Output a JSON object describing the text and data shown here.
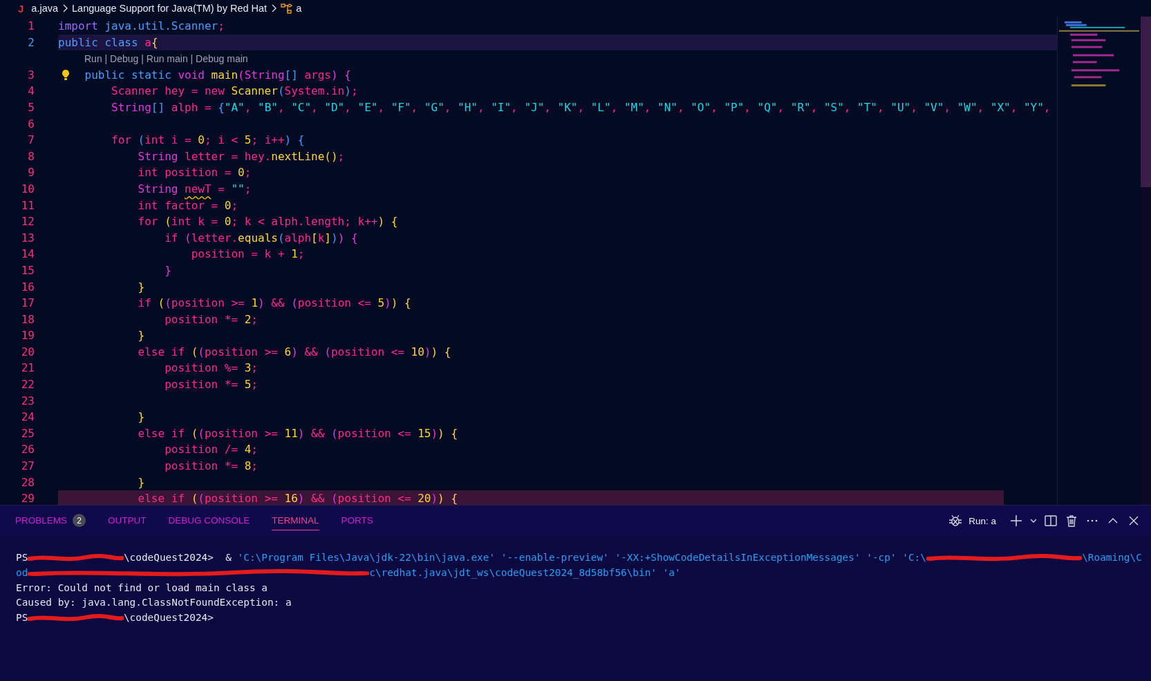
{
  "breadcrumb": {
    "file_icon": "J",
    "file": "a.java",
    "extension": "Language Support for Java(TM) by Red Hat",
    "symbol": "a"
  },
  "editor": {
    "lines": [
      {
        "kind": "code",
        "number": "1",
        "tokens": [
          {
            "kind": "im",
            "text": "import"
          },
          {
            "kind": "kw",
            "text": " java.util.Scanner"
          },
          {
            "kind": "id",
            "text": ";"
          }
        ]
      },
      {
        "kind": "current",
        "number": "2",
        "tokens": [
          {
            "kind": "kw",
            "text": "public class "
          },
          {
            "kind": "id",
            "text": "a"
          },
          {
            "kind": "y",
            "text": "{"
          }
        ]
      },
      {
        "kind": "codelens",
        "text": "Run | Debug | Run main | Debug main"
      },
      {
        "kind": "hint",
        "number": "3",
        "tokens": [
          {
            "kind": "kw",
            "text": "    public static "
          },
          {
            "kind": "ty",
            "text": "void "
          },
          {
            "kind": "fn",
            "text": "main"
          },
          {
            "kind": "m",
            "text": "("
          },
          {
            "kind": "ty",
            "text": "String"
          },
          {
            "kind": "b",
            "text": "[]"
          },
          {
            "kind": "id",
            "text": " args"
          },
          {
            "kind": "m",
            "text": ")"
          },
          {
            "kind": "m",
            "text": " {"
          }
        ]
      },
      {
        "kind": "code",
        "number": "4",
        "tokens": [
          {
            "kind": "id",
            "text": "        Scanner hey = new "
          },
          {
            "kind": "fn",
            "text": "Scanner"
          },
          {
            "kind": "b",
            "text": "("
          },
          {
            "kind": "id",
            "text": "System.in"
          },
          {
            "kind": "b",
            "text": ")"
          },
          {
            "kind": "id",
            "text": ";"
          }
        ]
      },
      {
        "kind": "code",
        "number": "5",
        "tokens": [
          {
            "kind": "ty",
            "text": "        String"
          },
          {
            "kind": "b",
            "text": "[]"
          },
          {
            "kind": "id",
            "text": " alph = "
          },
          {
            "kind": "b",
            "text": "{"
          },
          {
            "kind": "str",
            "text": "\"A\""
          },
          {
            "kind": "id",
            "text": ", "
          },
          {
            "kind": "str",
            "text": "\"B\""
          },
          {
            "kind": "id",
            "text": ", "
          },
          {
            "kind": "str",
            "text": "\"C\""
          },
          {
            "kind": "id",
            "text": ", "
          },
          {
            "kind": "str",
            "text": "\"D\""
          },
          {
            "kind": "id",
            "text": ", "
          },
          {
            "kind": "str",
            "text": "\"E\""
          },
          {
            "kind": "id",
            "text": ", "
          },
          {
            "kind": "str",
            "text": "\"F\""
          },
          {
            "kind": "id",
            "text": ", "
          },
          {
            "kind": "str",
            "text": "\"G\""
          },
          {
            "kind": "id",
            "text": ", "
          },
          {
            "kind": "str",
            "text": "\"H\""
          },
          {
            "kind": "id",
            "text": ", "
          },
          {
            "kind": "str",
            "text": "\"I\""
          },
          {
            "kind": "id",
            "text": ", "
          },
          {
            "kind": "str",
            "text": "\"J\""
          },
          {
            "kind": "id",
            "text": ", "
          },
          {
            "kind": "str",
            "text": "\"K\""
          },
          {
            "kind": "id",
            "text": ", "
          },
          {
            "kind": "str",
            "text": "\"L\""
          },
          {
            "kind": "id",
            "text": ", "
          },
          {
            "kind": "str",
            "text": "\"M\""
          },
          {
            "kind": "id",
            "text": ", "
          },
          {
            "kind": "str",
            "text": "\"N\""
          },
          {
            "kind": "id",
            "text": ", "
          },
          {
            "kind": "str",
            "text": "\"O\""
          },
          {
            "kind": "id",
            "text": ", "
          },
          {
            "kind": "str",
            "text": "\"P\""
          },
          {
            "kind": "id",
            "text": ", "
          },
          {
            "kind": "str",
            "text": "\"Q\""
          },
          {
            "kind": "id",
            "text": ", "
          },
          {
            "kind": "str",
            "text": "\"R\""
          },
          {
            "kind": "id",
            "text": ", "
          },
          {
            "kind": "str",
            "text": "\"S\""
          },
          {
            "kind": "id",
            "text": ", "
          },
          {
            "kind": "str",
            "text": "\"T\""
          },
          {
            "kind": "id",
            "text": ", "
          },
          {
            "kind": "str",
            "text": "\"U\""
          },
          {
            "kind": "id",
            "text": ", "
          },
          {
            "kind": "str",
            "text": "\"V\""
          },
          {
            "kind": "id",
            "text": ", "
          },
          {
            "kind": "str",
            "text": "\"W\""
          },
          {
            "kind": "id",
            "text": ", "
          },
          {
            "kind": "str",
            "text": "\"X\""
          },
          {
            "kind": "id",
            "text": ", "
          },
          {
            "kind": "str",
            "text": "\"Y\""
          },
          {
            "kind": "id",
            "text": ","
          }
        ]
      },
      {
        "kind": "code",
        "number": "6"
      },
      {
        "kind": "code",
        "number": "7",
        "tokens": [
          {
            "kind": "id",
            "text": "        for "
          },
          {
            "kind": "b",
            "text": "("
          },
          {
            "kind": "id",
            "text": "int i = "
          },
          {
            "kind": "num",
            "text": "0"
          },
          {
            "kind": "id",
            "text": "; i < "
          },
          {
            "kind": "num",
            "text": "5"
          },
          {
            "kind": "id",
            "text": "; i++"
          },
          {
            "kind": "b",
            "text": ")"
          },
          {
            "kind": "b",
            "text": " {"
          }
        ]
      },
      {
        "kind": "code",
        "number": "8",
        "tokens": [
          {
            "kind": "ty",
            "text": "            String"
          },
          {
            "kind": "id",
            "text": " letter = hey."
          },
          {
            "kind": "fn",
            "text": "nextLine"
          },
          {
            "kind": "y",
            "text": "()"
          },
          {
            "kind": "id",
            "text": ";"
          }
        ]
      },
      {
        "kind": "code",
        "number": "9",
        "tokens": [
          {
            "kind": "id",
            "text": "            int position = "
          },
          {
            "kind": "num",
            "text": "0"
          },
          {
            "kind": "id",
            "text": ";"
          }
        ]
      },
      {
        "kind": "code",
        "number": "10",
        "tokens": [
          {
            "kind": "ty",
            "text": "            String "
          },
          {
            "kind": "warn",
            "text": "newT"
          },
          {
            "kind": "id",
            "text": " = "
          },
          {
            "kind": "str",
            "text": "\"\""
          },
          {
            "kind": "id",
            "text": ";"
          }
        ]
      },
      {
        "kind": "code",
        "number": "11",
        "tokens": [
          {
            "kind": "id",
            "text": "            int factor = "
          },
          {
            "kind": "num",
            "text": "0"
          },
          {
            "kind": "id",
            "text": ";"
          }
        ]
      },
      {
        "kind": "code",
        "number": "12",
        "tokens": [
          {
            "kind": "id",
            "text": "            for "
          },
          {
            "kind": "y",
            "text": "("
          },
          {
            "kind": "id",
            "text": "int k = "
          },
          {
            "kind": "num",
            "text": "0"
          },
          {
            "kind": "id",
            "text": "; k < alph.length; k++"
          },
          {
            "kind": "y",
            "text": ")"
          },
          {
            "kind": "y",
            "text": " {"
          }
        ]
      },
      {
        "kind": "code",
        "number": "13",
        "tokens": [
          {
            "kind": "id",
            "text": "                if "
          },
          {
            "kind": "m",
            "text": "("
          },
          {
            "kind": "id",
            "text": "letter."
          },
          {
            "kind": "fn",
            "text": "equals"
          },
          {
            "kind": "b",
            "text": "("
          },
          {
            "kind": "id",
            "text": "alph"
          },
          {
            "kind": "y",
            "text": "["
          },
          {
            "kind": "id",
            "text": "k"
          },
          {
            "kind": "y",
            "text": "]"
          },
          {
            "kind": "b",
            "text": ")"
          },
          {
            "kind": "m",
            "text": ")"
          },
          {
            "kind": "m",
            "text": " {"
          }
        ]
      },
      {
        "kind": "code",
        "number": "14",
        "tokens": [
          {
            "kind": "id",
            "text": "                    position = k + "
          },
          {
            "kind": "num",
            "text": "1"
          },
          {
            "kind": "id",
            "text": ";"
          }
        ]
      },
      {
        "kind": "code",
        "number": "15",
        "tokens": [
          {
            "kind": "m",
            "text": "                }"
          }
        ]
      },
      {
        "kind": "code",
        "number": "16",
        "tokens": [
          {
            "kind": "y",
            "text": "            }"
          }
        ]
      },
      {
        "kind": "code",
        "number": "17",
        "tokens": [
          {
            "kind": "id",
            "text": "            if "
          },
          {
            "kind": "y",
            "text": "("
          },
          {
            "kind": "m",
            "text": "("
          },
          {
            "kind": "id",
            "text": "position >= "
          },
          {
            "kind": "num",
            "text": "1"
          },
          {
            "kind": "m",
            "text": ")"
          },
          {
            "kind": "id",
            "text": " && "
          },
          {
            "kind": "m",
            "text": "("
          },
          {
            "kind": "id",
            "text": "position <= "
          },
          {
            "kind": "num",
            "text": "5"
          },
          {
            "kind": "m",
            "text": ")"
          },
          {
            "kind": "y",
            "text": ")"
          },
          {
            "kind": "y",
            "text": " {"
          }
        ]
      },
      {
        "kind": "code",
        "number": "18",
        "tokens": [
          {
            "kind": "id",
            "text": "                position *= "
          },
          {
            "kind": "num",
            "text": "2"
          },
          {
            "kind": "id",
            "text": ";"
          }
        ]
      },
      {
        "kind": "code",
        "number": "19",
        "tokens": [
          {
            "kind": "y",
            "text": "            }"
          }
        ]
      },
      {
        "kind": "code",
        "number": "20",
        "tokens": [
          {
            "kind": "id",
            "text": "            else if "
          },
          {
            "kind": "y",
            "text": "("
          },
          {
            "kind": "m",
            "text": "("
          },
          {
            "kind": "id",
            "text": "position >= "
          },
          {
            "kind": "num",
            "text": "6"
          },
          {
            "kind": "m",
            "text": ")"
          },
          {
            "kind": "id",
            "text": " && "
          },
          {
            "kind": "m",
            "text": "("
          },
          {
            "kind": "id",
            "text": "position <= "
          },
          {
            "kind": "num",
            "text": "10"
          },
          {
            "kind": "m",
            "text": ")"
          },
          {
            "kind": "y",
            "text": ")"
          },
          {
            "kind": "y",
            "text": " {"
          }
        ]
      },
      {
        "kind": "code",
        "number": "21",
        "tokens": [
          {
            "kind": "id",
            "text": "                position %= "
          },
          {
            "kind": "num",
            "text": "3"
          },
          {
            "kind": "id",
            "text": ";"
          }
        ]
      },
      {
        "kind": "code",
        "number": "22",
        "tokens": [
          {
            "kind": "id",
            "text": "                position *= "
          },
          {
            "kind": "num",
            "text": "5"
          },
          {
            "kind": "id",
            "text": ";"
          }
        ]
      },
      {
        "kind": "code",
        "number": "23"
      },
      {
        "kind": "code",
        "number": "24",
        "tokens": [
          {
            "kind": "y",
            "text": "            }"
          }
        ]
      },
      {
        "kind": "code",
        "number": "25",
        "tokens": [
          {
            "kind": "id",
            "text": "            else if "
          },
          {
            "kind": "y",
            "text": "("
          },
          {
            "kind": "m",
            "text": "("
          },
          {
            "kind": "id",
            "text": "position >= "
          },
          {
            "kind": "num",
            "text": "11"
          },
          {
            "kind": "m",
            "text": ")"
          },
          {
            "kind": "id",
            "text": " && "
          },
          {
            "kind": "m",
            "text": "("
          },
          {
            "kind": "id",
            "text": "position <= "
          },
          {
            "kind": "num",
            "text": "15"
          },
          {
            "kind": "m",
            "text": ")"
          },
          {
            "kind": "y",
            "text": ")"
          },
          {
            "kind": "y",
            "text": " {"
          }
        ]
      },
      {
        "kind": "code",
        "number": "26",
        "tokens": [
          {
            "kind": "id",
            "text": "                position /= "
          },
          {
            "kind": "num",
            "text": "4"
          },
          {
            "kind": "id",
            "text": ";"
          }
        ]
      },
      {
        "kind": "code",
        "number": "27",
        "tokens": [
          {
            "kind": "id",
            "text": "                position *= "
          },
          {
            "kind": "num",
            "text": "8"
          },
          {
            "kind": "id",
            "text": ";"
          }
        ]
      },
      {
        "kind": "code",
        "number": "28",
        "tokens": [
          {
            "kind": "y",
            "text": "            }"
          }
        ]
      },
      {
        "kind": "match",
        "number": "29",
        "tokens": [
          {
            "kind": "id",
            "text": "            else if "
          },
          {
            "kind": "y",
            "text": "("
          },
          {
            "kind": "m",
            "text": "("
          },
          {
            "kind": "id",
            "text": "position >= "
          },
          {
            "kind": "num",
            "text": "16"
          },
          {
            "kind": "m",
            "text": ")"
          },
          {
            "kind": "id",
            "text": " && "
          },
          {
            "kind": "m",
            "text": "("
          },
          {
            "kind": "id",
            "text": "position <= "
          },
          {
            "kind": "num",
            "text": "20"
          },
          {
            "kind": "m",
            "text": ")"
          },
          {
            "kind": "y",
            "text": ")"
          },
          {
            "kind": "y",
            "text": " {"
          }
        ]
      }
    ]
  },
  "panel": {
    "tabs": [
      {
        "label": "PROBLEMS",
        "selected": false,
        "badge": "2"
      },
      {
        "label": "OUTPUT",
        "selected": false
      },
      {
        "label": "DEBUG CONSOLE",
        "selected": false
      },
      {
        "label": "TERMINAL",
        "selected": true
      },
      {
        "label": "PORTS",
        "selected": false
      }
    ],
    "terminal_name": "Run: a",
    "terminal": [
      {
        "segments": [
          {
            "kind": "text",
            "text": "PS"
          },
          {
            "kind": "redaction"
          },
          {
            "kind": "text",
            "text": "\\codeQuest2024>  & "
          },
          {
            "kind": "path",
            "text": "'C:\\Program Files\\Java\\jdk-22\\bin\\java.exe' '--enable-preview' '-XX:+ShowCodeDetailsInExceptionMessages' '-cp' 'C:\\"
          },
          {
            "kind": "redaction"
          },
          {
            "kind": "path",
            "text": "\\Roaming\\C"
          }
        ]
      },
      {
        "segments": [
          {
            "kind": "path",
            "text": "od"
          },
          {
            "kind": "redaction"
          },
          {
            "kind": "path",
            "text": "c\\redhat.java\\jdt_ws\\codeQuest2024_8d58bf56\\bin' 'a'"
          }
        ]
      },
      {
        "segments": [
          {
            "kind": "text",
            "text": "Error: Could not find or load main class a"
          }
        ]
      },
      {
        "segments": [
          {
            "kind": "text",
            "text": "Caused by: java.lang.ClassNotFoundException: a"
          }
        ]
      },
      {
        "segments": [
          {
            "kind": "text",
            "text": "PS"
          },
          {
            "kind": "redaction"
          },
          {
            "kind": "text",
            "text": "\\codeQuest2024>"
          }
        ]
      }
    ]
  }
}
